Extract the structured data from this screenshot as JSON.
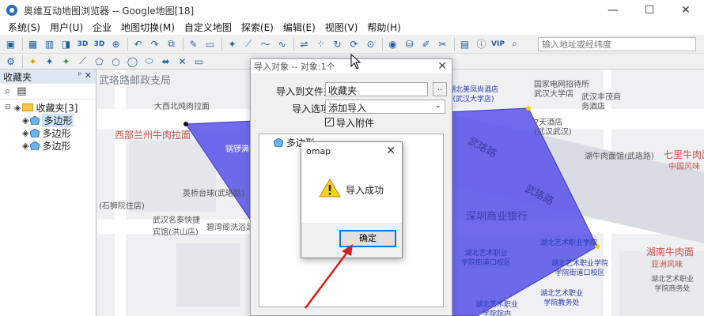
{
  "window": {
    "title": "奥维互动地图浏览器 -- Google地图[18]",
    "minimize": "—",
    "maximize": "☐",
    "close": "✕"
  },
  "menu": [
    "系统(S)",
    "用户(U)",
    "企业",
    "地图切换(M)",
    "自定义地图",
    "探索(E)",
    "编辑(E)",
    "视图(V)",
    "帮助(H)"
  ],
  "toolbar": {
    "address_placeholder": "输入地址或经纬度",
    "tool_3d": "3D",
    "tool_3d2": "3D",
    "tool_vip": "VIP"
  },
  "favorites_panel": {
    "title": "收藏夹",
    "pin": "ᵖ",
    "close": "✕",
    "root_label": "收藏夹[3]",
    "items": [
      "多边形",
      "多边形",
      "多边形"
    ]
  },
  "map": {
    "polygon_color": "#5b57e8",
    "labels": {
      "wuluolu_post": "武珞路邮政支局",
      "niurou_da": "大西北炖肉拉面",
      "lanzhou": "西部兰州牛肉拉面",
      "mianzhuan": "锅锣满仲",
      "yingqiao": "英桥台球(武珞路)",
      "shitou": "(石狮院住店)",
      "kuaijie": "武汉名泰快捷\n宾馆(洪山店)",
      "biqiao": "碧湾阁洗浴足浴",
      "national_hotel": "国家电网招待所\n武汉大学店",
      "fengmao": "武汉丰茂商\n务酒店",
      "tianmen": "7天酒店\n(武汉武汉)",
      "nianjia": "湖北美凤尚酒店\n(武汉大学店)",
      "niurou_east": "湖牛肉面馆(武珞路)",
      "wuluolu1": "武珞路",
      "wuluolu2": "武珞路",
      "shenzhen_bank": "深圳商业银行",
      "qijie": "七里牛肉面",
      "zhongguo": "中国风味",
      "hubei_yishu1": "湖北艺术职业学院",
      "hubei_yishu2": "湖北艺术职业\n学院街道口校区",
      "hubei_yishu3": "湖北艺术职业学院\n学院街道口校区",
      "hubei_yishu4": "湖北艺术职业\n学院教务处",
      "hubei_niurou": "湖南牛肉面",
      "yazhou": "亚洲风味",
      "hubei_shang": "湖北艺术职业\n学院商务处",
      "hubei_mid": "湖北艺术职业学院\n学院小学",
      "wuda": "湖北艺术职业\n学院院系",
      "lower1": "湖北艺术职业\n学院院内",
      "lower2": "湖北艺术职业\n学院办公楼"
    }
  },
  "import_dialog": {
    "title": "导入对象 -- 对象:1个",
    "folder_label": "导入到文件夹",
    "folder_value": "收藏夹",
    "browse": "..",
    "option_label": "导入选项",
    "option_value": "添加导入",
    "attach_label": "导入附件",
    "attach_checked": true,
    "list_item": "多边形"
  },
  "message_box": {
    "title": "omap",
    "message": "导入成功",
    "ok": "确定"
  }
}
